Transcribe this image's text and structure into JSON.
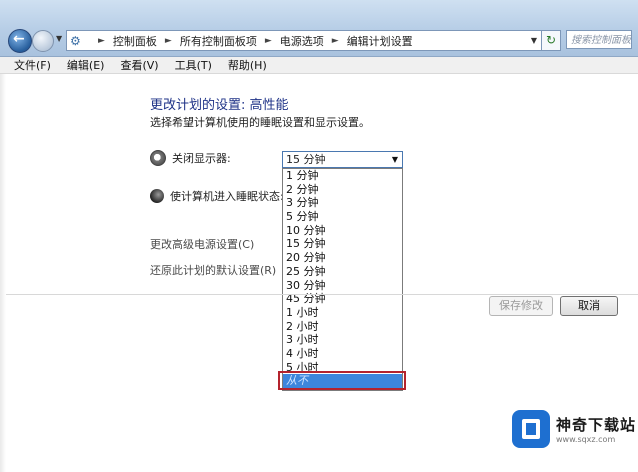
{
  "address": {
    "crumbs": [
      "控制面板",
      "所有控制面板项",
      "电源选项",
      "编辑计划设置"
    ],
    "search_placeholder": "搜索控制面板"
  },
  "menu": [
    "文件(F)",
    "编辑(E)",
    "查看(V)",
    "工具(T)",
    "帮助(H)"
  ],
  "page": {
    "title": "更改计划的设置: 高性能",
    "description": "选择希望计算机使用的睡眠设置和显示设置。"
  },
  "settings": {
    "display_label": "关闭显示器:",
    "sleep_label": "使计算机进入睡眠状态:",
    "display_value": "15 分钟"
  },
  "dropdown": {
    "options": [
      "1 分钟",
      "2 分钟",
      "3 分钟",
      "5 分钟",
      "10 分钟",
      "15 分钟",
      "20 分钟",
      "25 分钟",
      "30 分钟",
      "45 分钟",
      "1 小时",
      "2 小时",
      "3 小时",
      "4 小时",
      "5 小时",
      "从不"
    ],
    "selected_index": 15
  },
  "links": {
    "advanced": "更改高级电源设置(C)",
    "restore": "还原此计划的默认设置(R)"
  },
  "buttons": {
    "save": "保存修改",
    "cancel": "取消"
  },
  "watermark": {
    "title": "神奇下载站",
    "url": "www.sqxz.com"
  },
  "colors": {
    "accent": "#3d86dc",
    "highlight_border": "#b4232d",
    "title": "#1e3287"
  },
  "icons": {
    "display": "monitor-icon",
    "sleep": "moon-icon"
  }
}
